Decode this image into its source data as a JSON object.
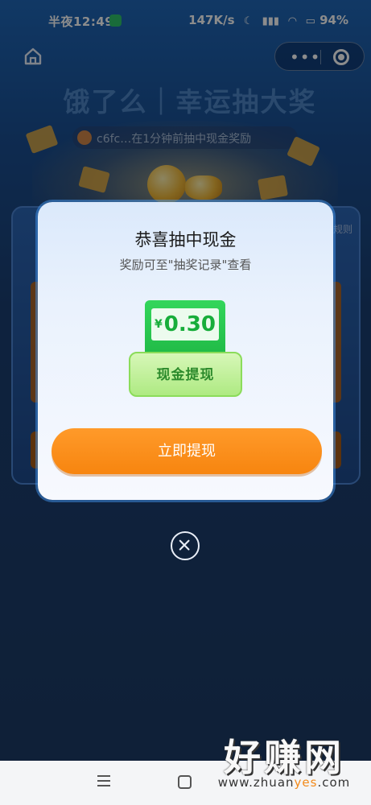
{
  "status_bar": {
    "time": "半夜12:49",
    "network_speed": "147K/s",
    "battery": "94%"
  },
  "banner": {
    "title": "饿了么｜幸运抽大奖",
    "ticker": "c6fc…在1分钟前抽中现金奖励"
  },
  "board": {
    "rules_label": "规则"
  },
  "modal": {
    "title": "恭喜抽中现金",
    "subtitle": "奖励可至\"抽奖记录\"查看",
    "currency_symbol": "¥",
    "amount": "0.30",
    "prize_label": "现金提现",
    "cta_label": "立即提现"
  },
  "watermark": {
    "text": "好赚网",
    "url_prefix": "www.zhuan",
    "url_highlight": "yes",
    "url_suffix": ".com"
  },
  "colors": {
    "accent_orange": "#f7850f",
    "prize_green": "#1fb845",
    "page_bg": "#1d3b66"
  },
  "icons": {
    "home": "home-icon",
    "more": "more-dots-icon",
    "target": "target-close-icon",
    "close": "close-x-icon",
    "nav_menu": "menu-icon",
    "nav_home": "square-home-icon"
  }
}
